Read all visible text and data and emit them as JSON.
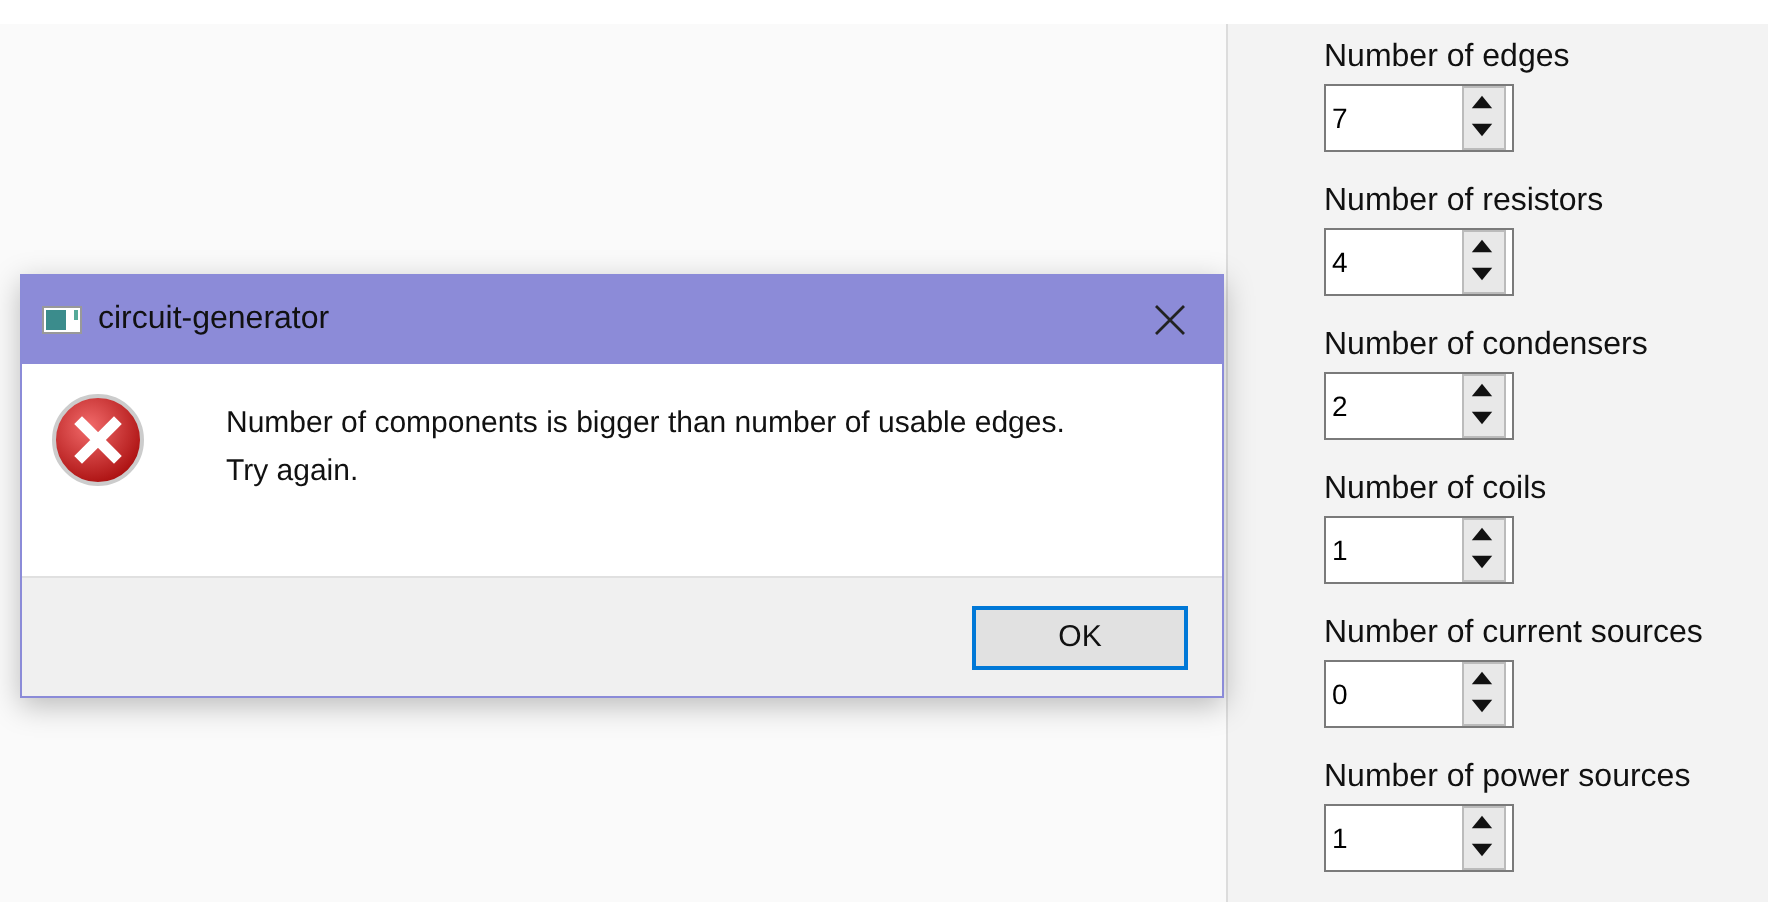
{
  "dialog": {
    "title": "circuit-generator",
    "message": [
      "Number of components is bigger than number of usable edges.",
      "Try again."
    ],
    "buttons": [
      "OK"
    ]
  },
  "fields": [
    {
      "label": "Number of edges",
      "value": "7"
    },
    {
      "label": "Number of resistors",
      "value": "4"
    },
    {
      "label": "Number of condensers",
      "value": "2"
    },
    {
      "label": "Number of coils",
      "value": "1"
    },
    {
      "label": "Number of current sources",
      "value": "0"
    },
    {
      "label": "Number of power sources",
      "value": "1"
    }
  ]
}
